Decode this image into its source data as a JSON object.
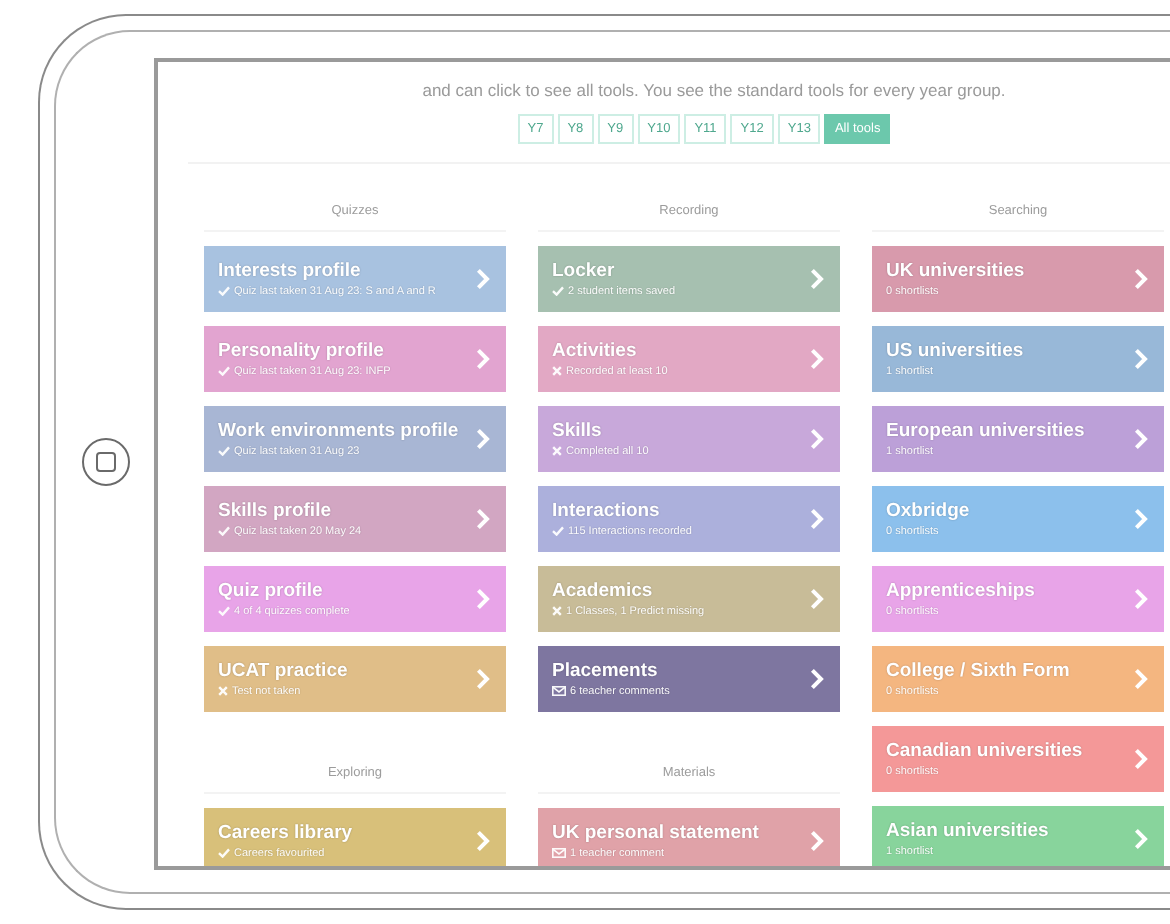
{
  "intro": "and can click to see all tools. You see the standard tools for every year group.",
  "year_filters": [
    {
      "label": "Y7",
      "selected": false
    },
    {
      "label": "Y8",
      "selected": false
    },
    {
      "label": "Y9",
      "selected": false
    },
    {
      "label": "Y10",
      "selected": false
    },
    {
      "label": "Y11",
      "selected": false
    },
    {
      "label": "Y12",
      "selected": false
    },
    {
      "label": "Y13",
      "selected": false
    },
    {
      "label": "All tools",
      "selected": true
    }
  ],
  "columns": [
    {
      "sections": [
        {
          "heading": "Quizzes",
          "cards": [
            {
              "title": "Interests profile",
              "kind": "check",
              "subtitle": "Quiz last taken 31 Aug 23: S and A and R",
              "color": "#a8c2e0"
            },
            {
              "title": "Personality profile",
              "kind": "check",
              "subtitle": "Quiz last taken 31 Aug 23: INFP",
              "color": "#e2a4d0"
            },
            {
              "title": "Work environments profile",
              "kind": "check",
              "subtitle": "Quiz last taken 31 Aug 23",
              "color": "#a8b6d4"
            },
            {
              "title": "Skills profile",
              "kind": "check",
              "subtitle": "Quiz last taken 20 May 24",
              "color": "#d2a6c2"
            },
            {
              "title": "Quiz profile",
              "kind": "check",
              "subtitle": "4 of 4 quizzes complete",
              "color": "#e8a4e8"
            },
            {
              "title": "UCAT practice",
              "kind": "cross",
              "subtitle": "Test not taken",
              "color": "#e0be88"
            }
          ]
        },
        {
          "heading": "Exploring",
          "cards": [
            {
              "title": "Careers library",
              "kind": "check",
              "subtitle": "Careers favourited",
              "color": "#d8c07a"
            }
          ]
        }
      ]
    },
    {
      "sections": [
        {
          "heading": "Recording",
          "cards": [
            {
              "title": "Locker",
              "kind": "check",
              "subtitle": "2 student items saved",
              "color": "#a6c0b0"
            },
            {
              "title": "Activities",
              "kind": "cross",
              "subtitle": "Recorded at least 10",
              "color": "#e2a8c4"
            },
            {
              "title": "Skills",
              "kind": "cross",
              "subtitle": "Completed all 10",
              "color": "#c8a8da"
            },
            {
              "title": "Interactions",
              "kind": "check",
              "subtitle": "115 Interactions recorded",
              "color": "#acb0dc"
            },
            {
              "title": "Academics",
              "kind": "cross",
              "subtitle": "1 Classes, 1 Predict missing",
              "color": "#c8bc98"
            },
            {
              "title": "Placements",
              "kind": "comment",
              "subtitle": "6 teacher comments",
              "color": "#7e76a0"
            }
          ]
        },
        {
          "heading": "Materials",
          "cards": [
            {
              "title": "UK personal statement",
              "kind": "comment",
              "subtitle": "1 teacher comment",
              "color": "#e0a2a8"
            }
          ]
        }
      ]
    },
    {
      "sections": [
        {
          "heading": "Searching",
          "cards": [
            {
              "title": "UK universities",
              "kind": "none",
              "subtitle": "0 shortlists",
              "color": "#d89aac"
            },
            {
              "title": "US universities",
              "kind": "none",
              "subtitle": "1 shortlist",
              "color": "#98b8d8"
            },
            {
              "title": "European universities",
              "kind": "none",
              "subtitle": "1 shortlist",
              "color": "#bca0d8"
            },
            {
              "title": "Oxbridge",
              "kind": "none",
              "subtitle": "0 shortlists",
              "color": "#8cc0ec"
            },
            {
              "title": "Apprenticeships",
              "kind": "none",
              "subtitle": "0 shortlists",
              "color": "#e8a4e8"
            },
            {
              "title": "College / Sixth Form",
              "kind": "none",
              "subtitle": "0 shortlists",
              "color": "#f4b680"
            },
            {
              "title": "Canadian universities",
              "kind": "none",
              "subtitle": "0 shortlists",
              "color": "#f49898"
            },
            {
              "title": "Asian universities",
              "kind": "none",
              "subtitle": "1 shortlist",
              "color": "#88d49c"
            }
          ]
        }
      ]
    }
  ]
}
